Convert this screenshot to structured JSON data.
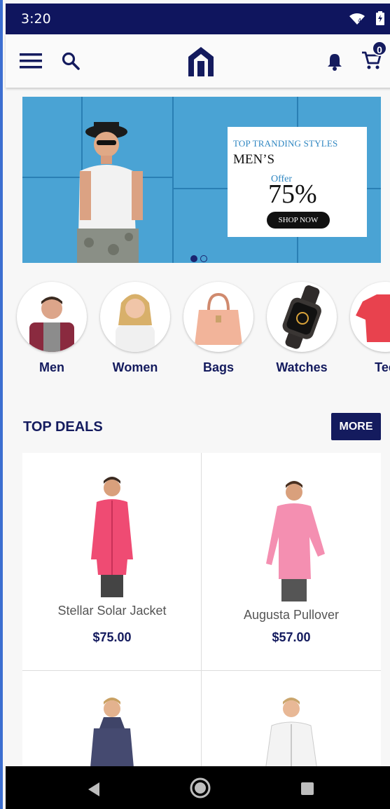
{
  "status_bar": {
    "time": "3:20",
    "wifi_icon": "wifi-icon",
    "battery_icon": "battery-charging-icon"
  },
  "app_bar": {
    "menu_icon": "hamburger-menu-icon",
    "search_icon": "search-icon",
    "logo_icon": "house-logo-icon",
    "notification_icon": "bell-icon",
    "cart_icon": "cart-icon",
    "cart_count": "0"
  },
  "banner": {
    "headline": "TOP TRANDING STYLES",
    "category": "MEN’S",
    "offer_label": "Offer",
    "offer_value": "75%",
    "cta": "SHOP NOW",
    "slides": 2,
    "active_slide": 1
  },
  "categories": [
    {
      "label": "Men"
    },
    {
      "label": "Women"
    },
    {
      "label": "Bags"
    },
    {
      "label": "Watches"
    },
    {
      "label": "Tee"
    }
  ],
  "top_deals": {
    "title": "TOP DEALS",
    "more_label": "MORE",
    "products": [
      {
        "name": "Stellar Solar Jacket",
        "price": "$75.00"
      },
      {
        "name": "Augusta Pullover",
        "price": "$57.00"
      },
      {
        "name": "",
        "price": ""
      },
      {
        "name": "",
        "price": ""
      }
    ]
  },
  "nav_bar": {
    "back_icon": "back-triangle-icon",
    "home_icon": "home-circle-icon",
    "recents_icon": "recents-square-icon"
  },
  "colors": {
    "brand": "#141b5e",
    "status_bar": "#0f155e",
    "banner": "#2e93c9"
  }
}
